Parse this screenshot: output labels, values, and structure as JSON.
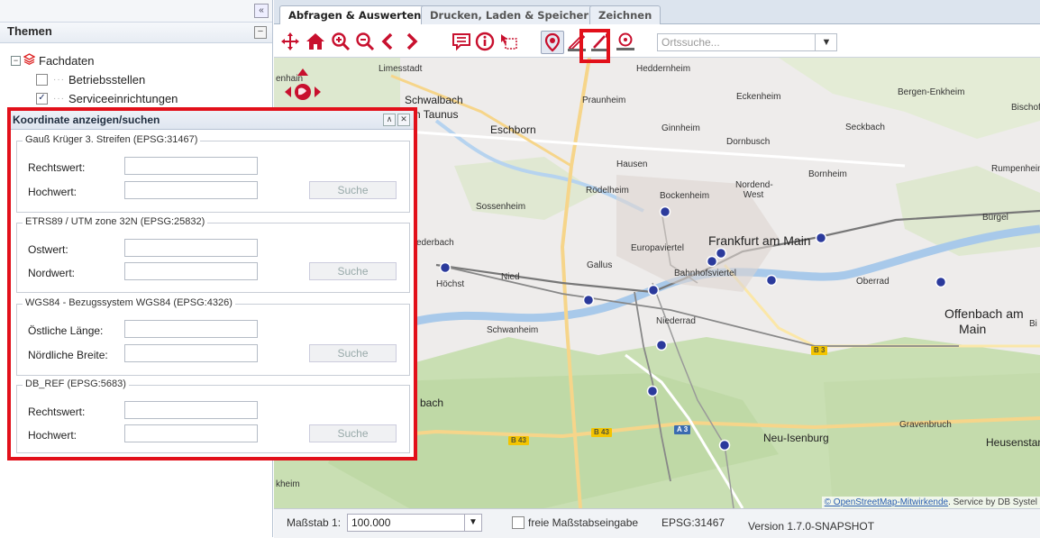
{
  "tabs": [
    {
      "label": "Abfragen & Auswerten",
      "active": true
    },
    {
      "label": "Drucken, Laden & Speichern",
      "active": false
    },
    {
      "label": "Zeichnen",
      "active": false
    }
  ],
  "left_panel": {
    "collapse_symbol": "«",
    "themen_title": "Themen",
    "minimize_symbol": "−",
    "tree": [
      {
        "label": "Fachdaten",
        "type": "folder",
        "icon": "layers-icon"
      },
      {
        "label": "Betriebsstellen",
        "type": "layer",
        "checked": false
      },
      {
        "label": "Serviceeinrichtungen",
        "type": "layer",
        "checked": true
      }
    ]
  },
  "toolbar": {
    "icons": [
      "pan-icon",
      "home-icon",
      "zoom-in-icon",
      "zoom-out-icon",
      "back-icon",
      "forward-icon",
      "speech-bubble-icon",
      "info-icon",
      "select-rect-icon",
      "locate-pin-icon",
      "measure-distance-icon",
      "measure-area-icon",
      "coordinate-icon"
    ],
    "search_placeholder": "Ortssuche..."
  },
  "dialog": {
    "title": "Koordinate anzeigen/suchen",
    "groups": [
      {
        "legend": "Gauß Krüger 3. Streifen (EPSG:31467)",
        "fields": [
          "Rechtswert:",
          "Hochwert:"
        ],
        "button": "Suche"
      },
      {
        "legend": "ETRS89 / UTM zone 32N (EPSG:25832)",
        "fields": [
          "Ostwert:",
          "Nordwert:"
        ],
        "button": "Suche"
      },
      {
        "legend": "WGS84 - Bezugssystem WGS84 (EPSG:4326)",
        "fields": [
          "Östliche Länge:",
          "Nördliche Breite:"
        ],
        "button": "Suche"
      },
      {
        "legend": "DB_REF (EPSG:5683)",
        "fields": [
          "Rechtswert:",
          "Hochwert:"
        ],
        "button": "Suche"
      }
    ]
  },
  "map": {
    "places": [
      "Limesstadt",
      "Heddernheim",
      "Schwalbach",
      "am Taunus",
      "Praunheim",
      "Eckenheim",
      "Bergen-Enkheim",
      "Bischofsheim",
      "Eschborn",
      "Ginnheim",
      "Dornbusch",
      "Seckbach",
      "Hausen",
      "Bornheim",
      "Rumpenheim",
      "Rödelheim",
      "Bockenheim",
      "Nordend-West",
      "Sossenheim",
      "Bürgel",
      "Frankfurt am Main",
      "Europaviertel",
      "Gallus",
      "Bahnhofsviertel",
      "Nied",
      "Höchst",
      "Oberrad",
      "Offenbach am",
      "Main",
      "Niederrad",
      "Schwanheim",
      "Gravenbruch",
      "Neu-Isenburg",
      "Heusenstamm",
      "enhain",
      "ederbach",
      "bach",
      "kheim",
      "Bi"
    ],
    "road_badges": [
      "B 3",
      "B 43",
      "A 3",
      "B 43"
    ],
    "attribution_link": "© OpenStreetMap-Mitwirkende",
    "attribution_text": ". Service by DB Systel"
  },
  "status": {
    "scale_label": "Maßstab 1:",
    "scale_value": "100.000",
    "free_scale_label": "freie Maßstabseingabe",
    "epsg": "EPSG:31467",
    "version": "Version 1.7.0-SNAPSHOT"
  },
  "colors": {
    "accent_red": "#c8102e",
    "highlight": "#e2101a",
    "station_dot": "#2b3a9c"
  }
}
